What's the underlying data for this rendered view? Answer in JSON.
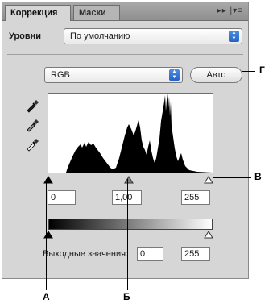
{
  "tabs": [
    {
      "label": "Коррекция"
    },
    {
      "label": "Маски"
    }
  ],
  "toolbar": {
    "icons": [
      "forward-arrows-icon",
      "panel-menu-icon"
    ],
    "glyph": "▸▸ |▾≡"
  },
  "preset": {
    "label": "Уровни",
    "value": "По умолчанию"
  },
  "channel": {
    "value": "RGB"
  },
  "auto_button": {
    "label": "Авто"
  },
  "eyedroppers": [
    "black-point-eyedropper-icon",
    "gray-point-eyedropper-icon",
    "white-point-eyedropper-icon"
  ],
  "input_levels": {
    "black": "0",
    "gamma": "1,00",
    "white": "255"
  },
  "output_levels": {
    "label": "Выходные значения:",
    "black": "0",
    "white": "255"
  },
  "callouts": {
    "a": "А",
    "b": "Б",
    "v": "В",
    "g": "Г"
  },
  "colors": {
    "panel_bg": "#d6d6d6",
    "accent_blue": "#2563c4"
  }
}
